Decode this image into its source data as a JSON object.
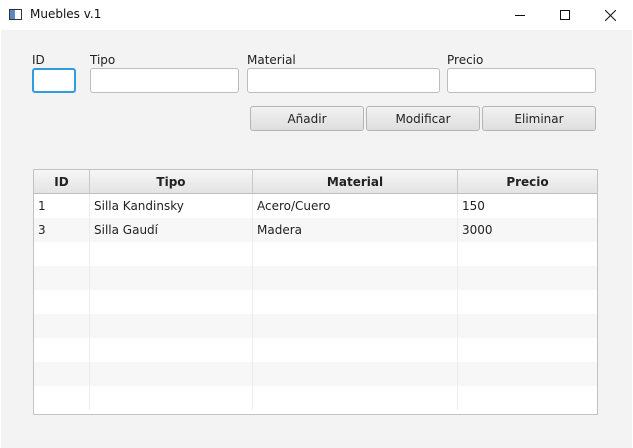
{
  "window": {
    "title": "Muebles v.1",
    "controls": [
      "minimize-icon",
      "maximize-icon",
      "close-icon"
    ]
  },
  "form": {
    "id_label": "ID",
    "id_value": "",
    "tipo_label": "Tipo",
    "tipo_value": "",
    "material_label": "Material",
    "material_value": "",
    "precio_label": "Precio",
    "precio_value": ""
  },
  "buttons": {
    "add": "Añadir",
    "modify": "Modificar",
    "delete": "Eliminar"
  },
  "table": {
    "columns": [
      "ID",
      "Tipo",
      "Material",
      "Precio"
    ],
    "rows": [
      [
        "1",
        "Silla Kandinsky",
        "Acero/Cuero",
        "150"
      ],
      [
        "3",
        "Silla Gaudí",
        "Madera",
        "3000"
      ]
    ]
  },
  "colors": {
    "focus": "#2f9ce0",
    "background": "#f3f3f3"
  }
}
